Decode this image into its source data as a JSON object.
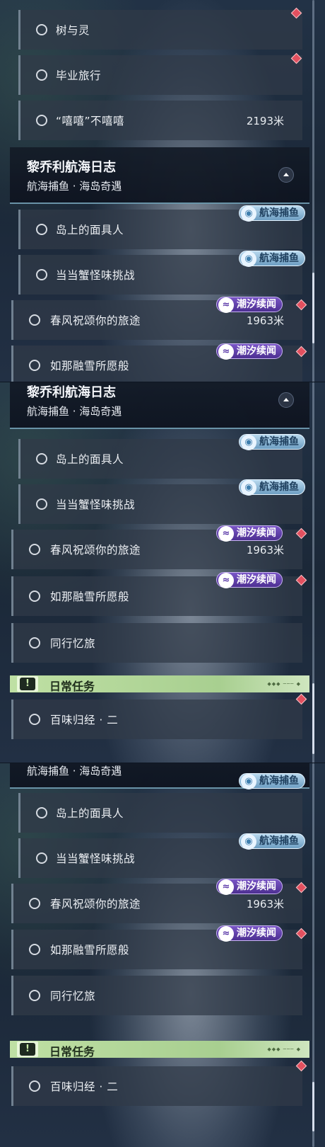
{
  "panel_a": {
    "tasks_top": [
      {
        "label": "树与灵"
      },
      {
        "label": "毕业旅行"
      },
      {
        "label": "“嘻嘻”不嘻嘻",
        "distance": "2193米"
      }
    ],
    "group": {
      "title": "黎乔利航海日志",
      "subtitle": "航海捕鱼 · 海岛奇遇"
    },
    "tasks": [
      {
        "label": "岛上的面具人"
      },
      {
        "label": "当当蟹怪味挑战"
      },
      {
        "label": "春风祝颂你的旅途",
        "distance": "1963米"
      },
      {
        "label": "如那融雪所愿般"
      }
    ]
  },
  "panel_b": {
    "group": {
      "title": "黎乔利航海日志",
      "subtitle": "航海捕鱼 · 海岛奇遇"
    },
    "tasks": [
      {
        "label": "岛上的面具人"
      },
      {
        "label": "当当蟹怪味挑战"
      },
      {
        "label": "春风祝颂你的旅途",
        "distance": "1963米"
      },
      {
        "label": "如那融雪所愿般"
      },
      {
        "label": "同行忆旅"
      }
    ],
    "daily": {
      "label": "日常任务",
      "icon": "!"
    },
    "daily_tasks": [
      {
        "label": "百味归经 · 二"
      }
    ]
  },
  "panel_c": {
    "group": {
      "subtitle": "航海捕鱼 · 海岛奇遇"
    },
    "tasks": [
      {
        "label": "岛上的面具人"
      },
      {
        "label": "当当蟹怪味挑战"
      },
      {
        "label": "春风祝颂你的旅途",
        "distance": "1963米"
      },
      {
        "label": "如那融雪所愿般"
      },
      {
        "label": "同行忆旅"
      }
    ],
    "daily": {
      "label": "日常任务",
      "icon": "!"
    },
    "daily_tasks": [
      {
        "label": "百味归经 · 二"
      }
    ]
  },
  "badges": {
    "fishing": "航海捕鱼",
    "tide": "潮汐续闻",
    "fishing_icon": "fish-icon",
    "tide_icon": "wave-icon"
  },
  "colors": {
    "marker": "#e2505f",
    "daily_bar": "#bfe0a4",
    "tide_badge": "#6a46b8",
    "fishing_badge": "#9cc4e0"
  }
}
